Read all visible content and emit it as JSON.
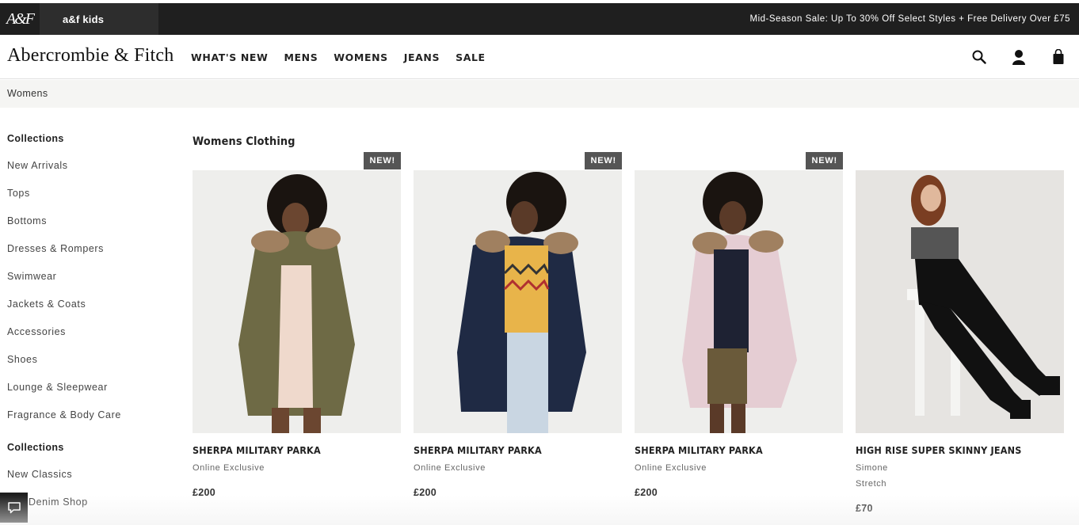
{
  "topbar": {
    "logo_text": "A&F",
    "kids_label": "a&f kids",
    "promo": "Mid-Season Sale: Up To 30% Off Select Styles + Free Delivery Over £75"
  },
  "header": {
    "brand": "Abercrombie & Fitch",
    "nav": [
      "WHAT'S NEW",
      "MENS",
      "WOMENS",
      "JEANS",
      "SALE"
    ],
    "icons": [
      "search-icon",
      "account-icon",
      "bag-icon"
    ]
  },
  "breadcrumb": "Womens",
  "sidebar": {
    "heading1": "Collections",
    "items1": [
      "New Arrivals",
      "Tops",
      "Bottoms",
      "Dresses & Rompers",
      "Swimwear",
      "Jackets & Coats",
      "Accessories",
      "Shoes",
      "Lounge & Sleepwear",
      "Fragrance & Body Care"
    ],
    "heading2": "Collections",
    "items2": [
      "New Classics",
      "Denim Shop"
    ]
  },
  "section_title": "Womens Clothing",
  "products": [
    {
      "badge": "NEW!",
      "name": "SHERPA MILITARY PARKA",
      "sub1": "Online Exclusive",
      "sub2": "",
      "price": "£200",
      "coat_color": "#6e6a45"
    },
    {
      "badge": "NEW!",
      "name": "SHERPA MILITARY PARKA",
      "sub1": "Online Exclusive",
      "sub2": "",
      "price": "£200",
      "coat_color": "#1f2a44"
    },
    {
      "badge": "NEW!",
      "name": "SHERPA MILITARY PARKA",
      "sub1": "Online Exclusive",
      "sub2": "",
      "price": "£200",
      "coat_color": "#e5cdd3"
    },
    {
      "badge": "",
      "name": "HIGH RISE SUPER SKINNY JEANS",
      "sub1": "Simone",
      "sub2": "Stretch",
      "price": "£70",
      "coat_color": "#111111"
    }
  ],
  "chat_icon": "chat-icon"
}
